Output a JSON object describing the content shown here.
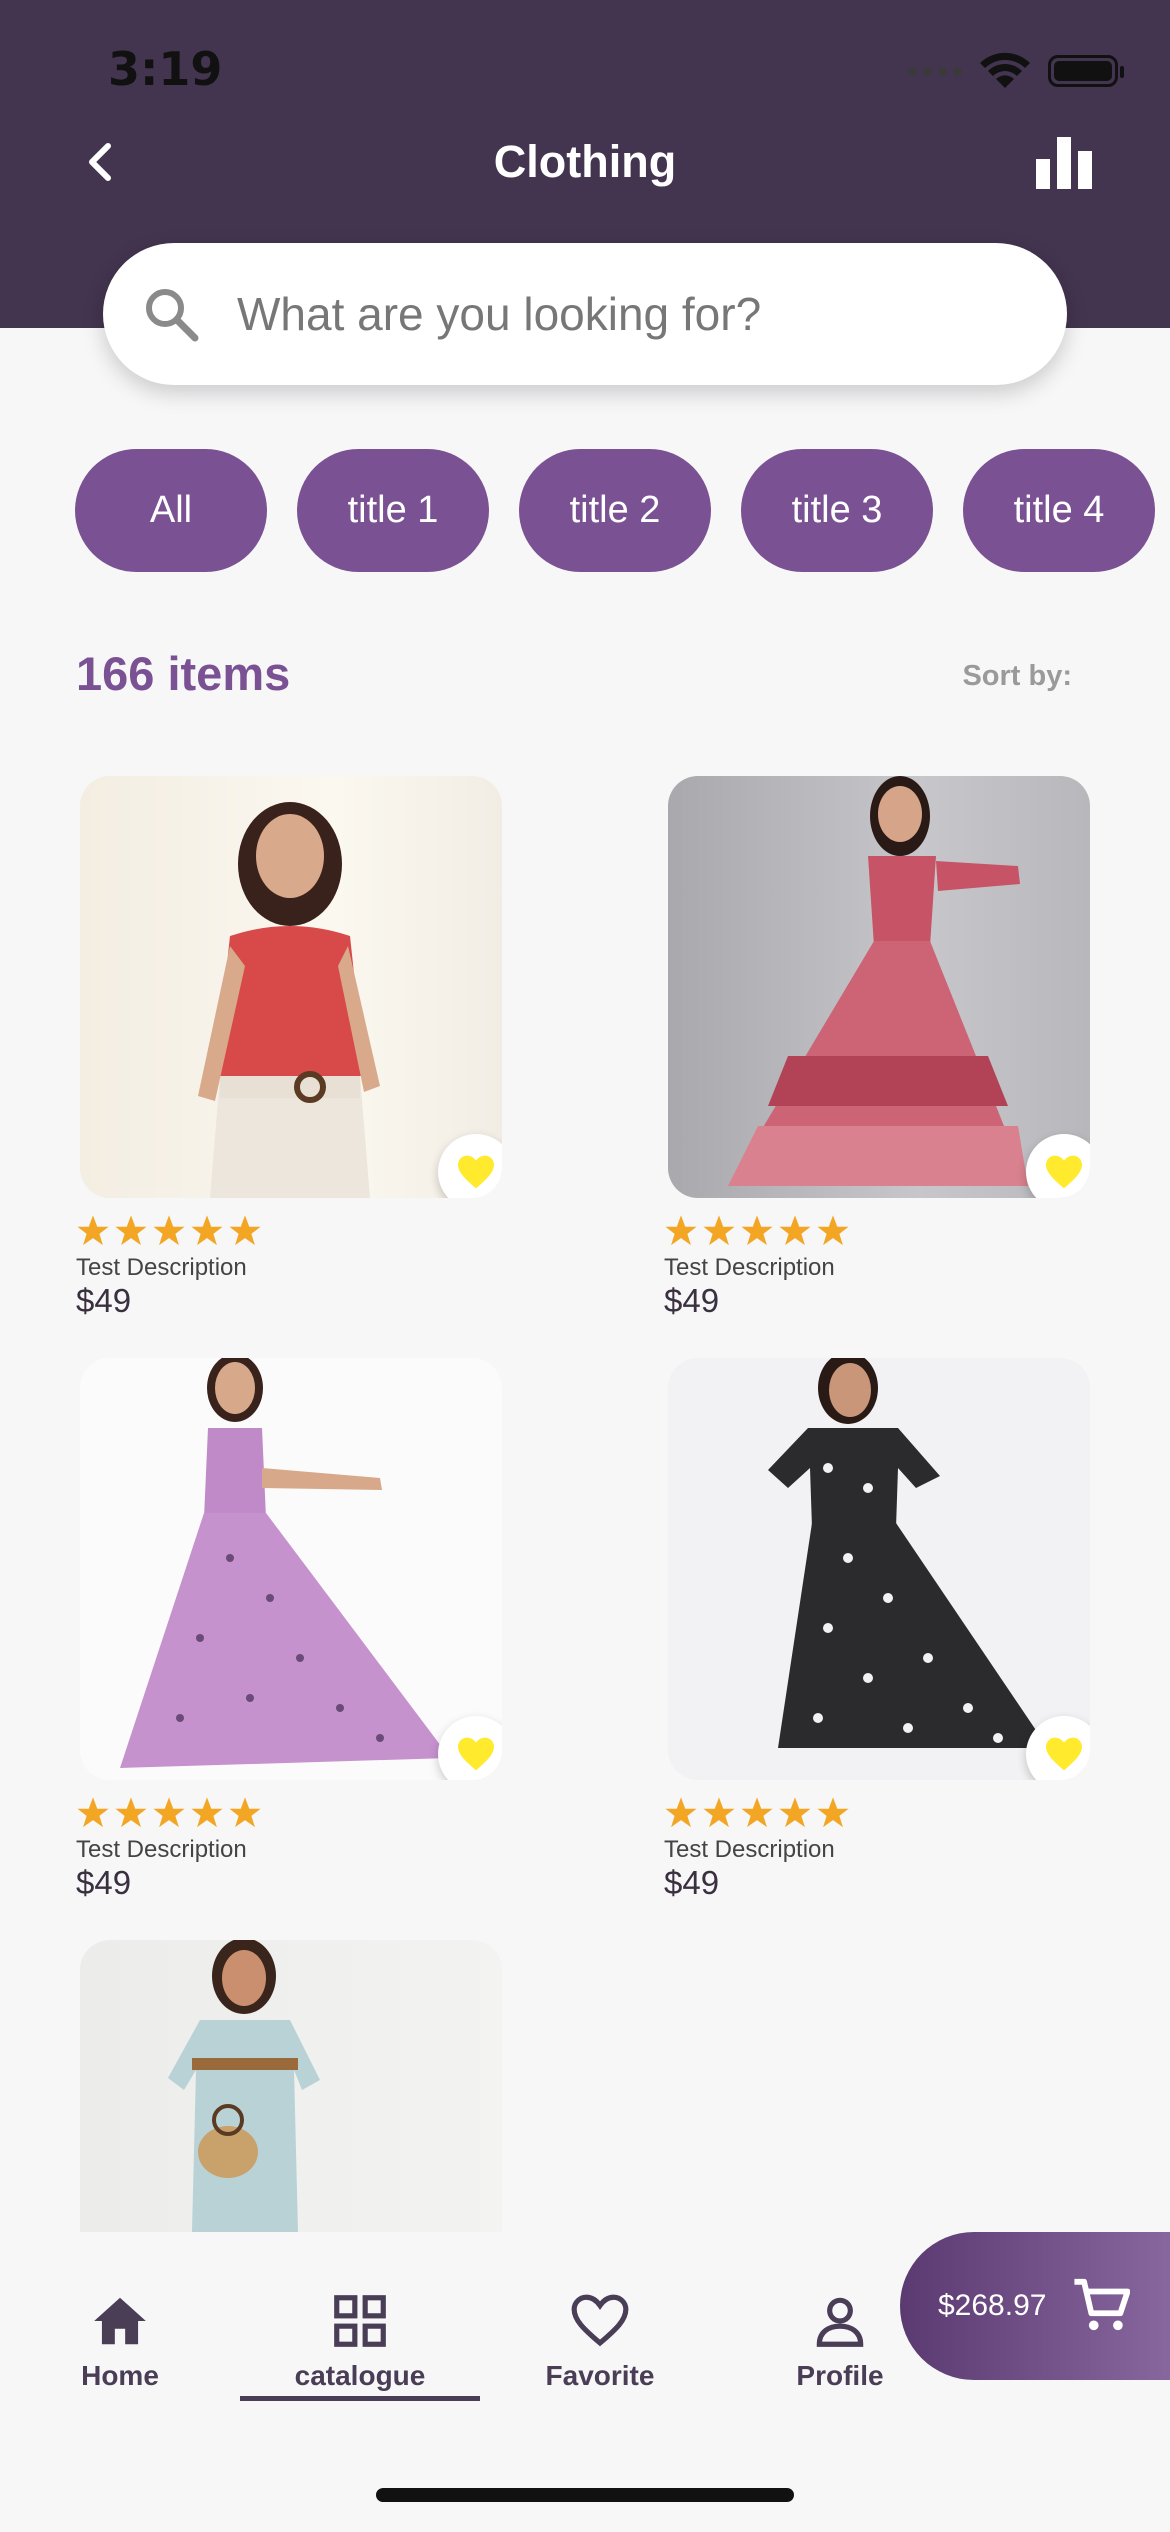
{
  "status_bar": {
    "time": "3:19"
  },
  "header": {
    "title": "Clothing",
    "back_icon": "chevron-left-icon",
    "action_icon": "bar-chart-icon"
  },
  "search": {
    "placeholder": "What are you looking for?",
    "value": ""
  },
  "filters": {
    "chips": [
      "All",
      "title 1",
      "title 2",
      "title 3",
      "title 4"
    ]
  },
  "summary": {
    "count": "166 items",
    "sort_label": "Sort by:"
  },
  "products": [
    {
      "description": "Test Description",
      "price": "$49",
      "rating": 5,
      "image": "model in red blouse and white pants"
    },
    {
      "description": "Test Description",
      "price": "$49",
      "rating": 5,
      "image": "model in pink patchwork maxi dress"
    },
    {
      "description": "Test Description",
      "price": "$49",
      "rating": 5,
      "image": "model in lilac printed maxi dress"
    },
    {
      "description": "Test Description",
      "price": "$49",
      "rating": 5,
      "image": "model in black polka dot dress"
    },
    {
      "description": "",
      "price": "",
      "rating": 0,
      "image": "model in light blue dress with straw bag"
    }
  ],
  "cart": {
    "total": "$268.97",
    "icon": "cart-icon"
  },
  "nav": [
    {
      "label": "Home",
      "icon": "home-icon",
      "active": false
    },
    {
      "label": "catalogue",
      "icon": "grid-icon",
      "active": true
    },
    {
      "label": "Favorite",
      "icon": "heart-outline-icon",
      "active": false
    },
    {
      "label": "Profile",
      "icon": "person-icon",
      "active": false
    }
  ],
  "colors": {
    "header_bg": "#43344f",
    "accent": "#7a5294",
    "star": "#f2a623",
    "heart": "#ffea2e"
  }
}
